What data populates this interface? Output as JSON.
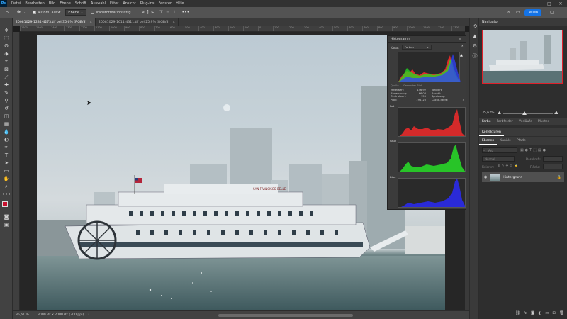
{
  "app": {
    "logo": "Ps",
    "menu": [
      "Datei",
      "Bearbeiten",
      "Bild",
      "Ebene",
      "Schrift",
      "Auswahl",
      "Filter",
      "Ansicht",
      "Plug-ins",
      "Fenster",
      "Hilfe"
    ],
    "window_controls": [
      "—",
      "□",
      "✕"
    ]
  },
  "options": {
    "auto_select_label": "Autom. ausw.:",
    "layer_mode": "Ebene",
    "transform_label": "Transformationsstrg.",
    "share_label": "Teilen"
  },
  "tabs": [
    {
      "label": "20081029-1234-4273.tif bei 35,6% (RGB/8)",
      "active": true
    },
    {
      "label": "20081029-1611-4311.tif bei 25,9% (RGB/8)",
      "active": false
    }
  ],
  "ruler_ticks": [
    "1600",
    "1500",
    "1400",
    "1300",
    "1200",
    "1100",
    "1000",
    "900",
    "800",
    "700",
    "600",
    "500",
    "400",
    "300",
    "200",
    "100",
    "0",
    "100",
    "200",
    "300",
    "400",
    "500",
    "600",
    "700",
    "800",
    "900",
    "1000",
    "1100",
    "1200",
    "1300"
  ],
  "status": {
    "zoom": "35,61 %",
    "doc_size": "3000 Px x 2000 Px (300 ppi)",
    "arrow": "›"
  },
  "histogram": {
    "title": "Histogramm",
    "channel_label": "Kanal:",
    "channel_value": "Farben",
    "source_a": "Quelle",
    "source_b": "Gesamtes Bild",
    "stats_left": [
      {
        "k": "Mittelwert:",
        "v": "146,92"
      },
      {
        "k": "Abweichung:",
        "v": "66,08"
      },
      {
        "k": "Zentralwert:",
        "v": "155"
      },
      {
        "k": "Pixel:",
        "v": "198120"
      }
    ],
    "stats_right": [
      {
        "k": "Tonwert:",
        "v": ""
      },
      {
        "k": "Anzahl:",
        "v": ""
      },
      {
        "k": "Spreizung:",
        "v": ""
      },
      {
        "k": "Cache-Stufe:",
        "v": "4"
      }
    ],
    "channels": [
      {
        "name": "Rot",
        "color": "#d42a2a"
      },
      {
        "name": "Grün",
        "color": "#28c428"
      },
      {
        "name": "Blau",
        "color": "#2a2ad8"
      }
    ]
  },
  "navigator": {
    "title": "Navigator",
    "zoom": "35,62%"
  },
  "properties_tabs": [
    "Farbe",
    "Farbfelder",
    "Verläufe",
    "Muster"
  ],
  "corrections_title": "Korrekturen",
  "layers": {
    "tabs": [
      "Ebenen",
      "Kanäle",
      "Pfade"
    ],
    "filter_placeholder": "Art",
    "blend_mode": "Normal",
    "opacity_label": "Deckkraft:",
    "lock_label": "Fixieren:",
    "fill_label": "Fläche:",
    "layer_name": "Hintergrund"
  },
  "photo": {
    "ship_sign": "SAN FRANCISCO BELLE"
  }
}
